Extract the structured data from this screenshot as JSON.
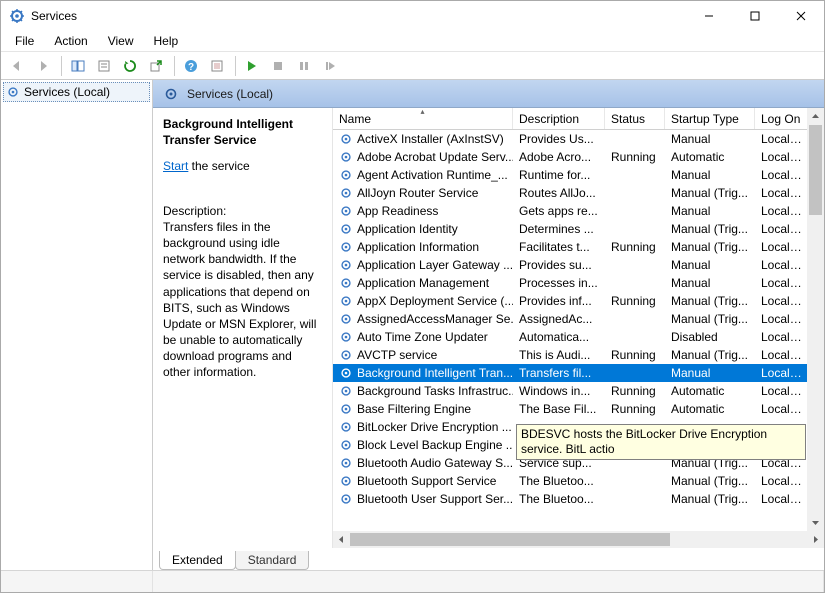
{
  "window": {
    "title": "Services"
  },
  "menu": {
    "file": "File",
    "action": "Action",
    "view": "View",
    "help": "Help"
  },
  "nav": {
    "root": "Services (Local)"
  },
  "header_band": {
    "label": "Services (Local)"
  },
  "detail": {
    "title": "Background Intelligent Transfer Service",
    "start_link": "Start",
    "start_suffix": " the service",
    "desc_label": "Description:",
    "desc_body": "Transfers files in the background using idle network bandwidth. If the service is disabled, then any applications that depend on BITS, such as Windows Update or MSN Explorer, will be unable to automatically download programs and other information."
  },
  "columns": {
    "name": "Name",
    "description": "Description",
    "status": "Status",
    "startup": "Startup Type",
    "logon": "Log On"
  },
  "widths": {
    "name": 180,
    "description": 92,
    "status": 60,
    "startup": 90,
    "logon": 56
  },
  "tooltip": "BDESVC hosts the BitLocker Drive Encryption service. BitL actio",
  "tabs": {
    "extended": "Extended",
    "standard": "Standard"
  },
  "services": [
    {
      "name": "ActiveX Installer (AxInstSV)",
      "desc": "Provides Us...",
      "status": "",
      "startup": "Manual",
      "logon": "Local Sy"
    },
    {
      "name": "Adobe Acrobat Update Serv...",
      "desc": "Adobe Acro...",
      "status": "Running",
      "startup": "Automatic",
      "logon": "Local Sy"
    },
    {
      "name": "Agent Activation Runtime_...",
      "desc": "Runtime for...",
      "status": "",
      "startup": "Manual",
      "logon": "Local Sy"
    },
    {
      "name": "AllJoyn Router Service",
      "desc": "Routes AllJo...",
      "status": "",
      "startup": "Manual (Trig...",
      "logon": "Local Se"
    },
    {
      "name": "App Readiness",
      "desc": "Gets apps re...",
      "status": "",
      "startup": "Manual",
      "logon": "Local Sy"
    },
    {
      "name": "Application Identity",
      "desc": "Determines ...",
      "status": "",
      "startup": "Manual (Trig...",
      "logon": "Local Se"
    },
    {
      "name": "Application Information",
      "desc": "Facilitates t...",
      "status": "Running",
      "startup": "Manual (Trig...",
      "logon": "Local Sy"
    },
    {
      "name": "Application Layer Gateway ...",
      "desc": "Provides su...",
      "status": "",
      "startup": "Manual",
      "logon": "Local Se"
    },
    {
      "name": "Application Management",
      "desc": "Processes in...",
      "status": "",
      "startup": "Manual",
      "logon": "Local Sy"
    },
    {
      "name": "AppX Deployment Service (...",
      "desc": "Provides inf...",
      "status": "Running",
      "startup": "Manual (Trig...",
      "logon": "Local Sy"
    },
    {
      "name": "AssignedAccessManager Se...",
      "desc": "AssignedAc...",
      "status": "",
      "startup": "Manual (Trig...",
      "logon": "Local Sy"
    },
    {
      "name": "Auto Time Zone Updater",
      "desc": "Automatica...",
      "status": "",
      "startup": "Disabled",
      "logon": "Local Se"
    },
    {
      "name": "AVCTP service",
      "desc": "This is Audi...",
      "status": "Running",
      "startup": "Manual (Trig...",
      "logon": "Local Se"
    },
    {
      "name": "Background Intelligent Tran...",
      "desc": "Transfers fil...",
      "status": "",
      "startup": "Manual",
      "logon": "Local Sy",
      "selected": true
    },
    {
      "name": "Background Tasks Infrastruc...",
      "desc": "Windows in...",
      "status": "Running",
      "startup": "Automatic",
      "logon": "Local Sy"
    },
    {
      "name": "Base Filtering Engine",
      "desc": "The Base Fil...",
      "status": "Running",
      "startup": "Automatic",
      "logon": "Local Se"
    },
    {
      "name": "BitLocker Drive Encryption ...",
      "desc": "",
      "status": "",
      "startup": "",
      "logon": "",
      "tooltip": true
    },
    {
      "name": "Block Level Backup Engine ...",
      "desc": "",
      "status": "",
      "startup": "",
      "logon": ""
    },
    {
      "name": "Bluetooth Audio Gateway S...",
      "desc": "Service sup...",
      "status": "",
      "startup": "Manual (Trig...",
      "logon": "Local Se"
    },
    {
      "name": "Bluetooth Support Service",
      "desc": "The Bluetoo...",
      "status": "",
      "startup": "Manual (Trig...",
      "logon": "Local Se"
    },
    {
      "name": "Bluetooth User Support Ser...",
      "desc": "The Bluetoo...",
      "status": "",
      "startup": "Manual (Trig...",
      "logon": "Local Sy"
    }
  ]
}
